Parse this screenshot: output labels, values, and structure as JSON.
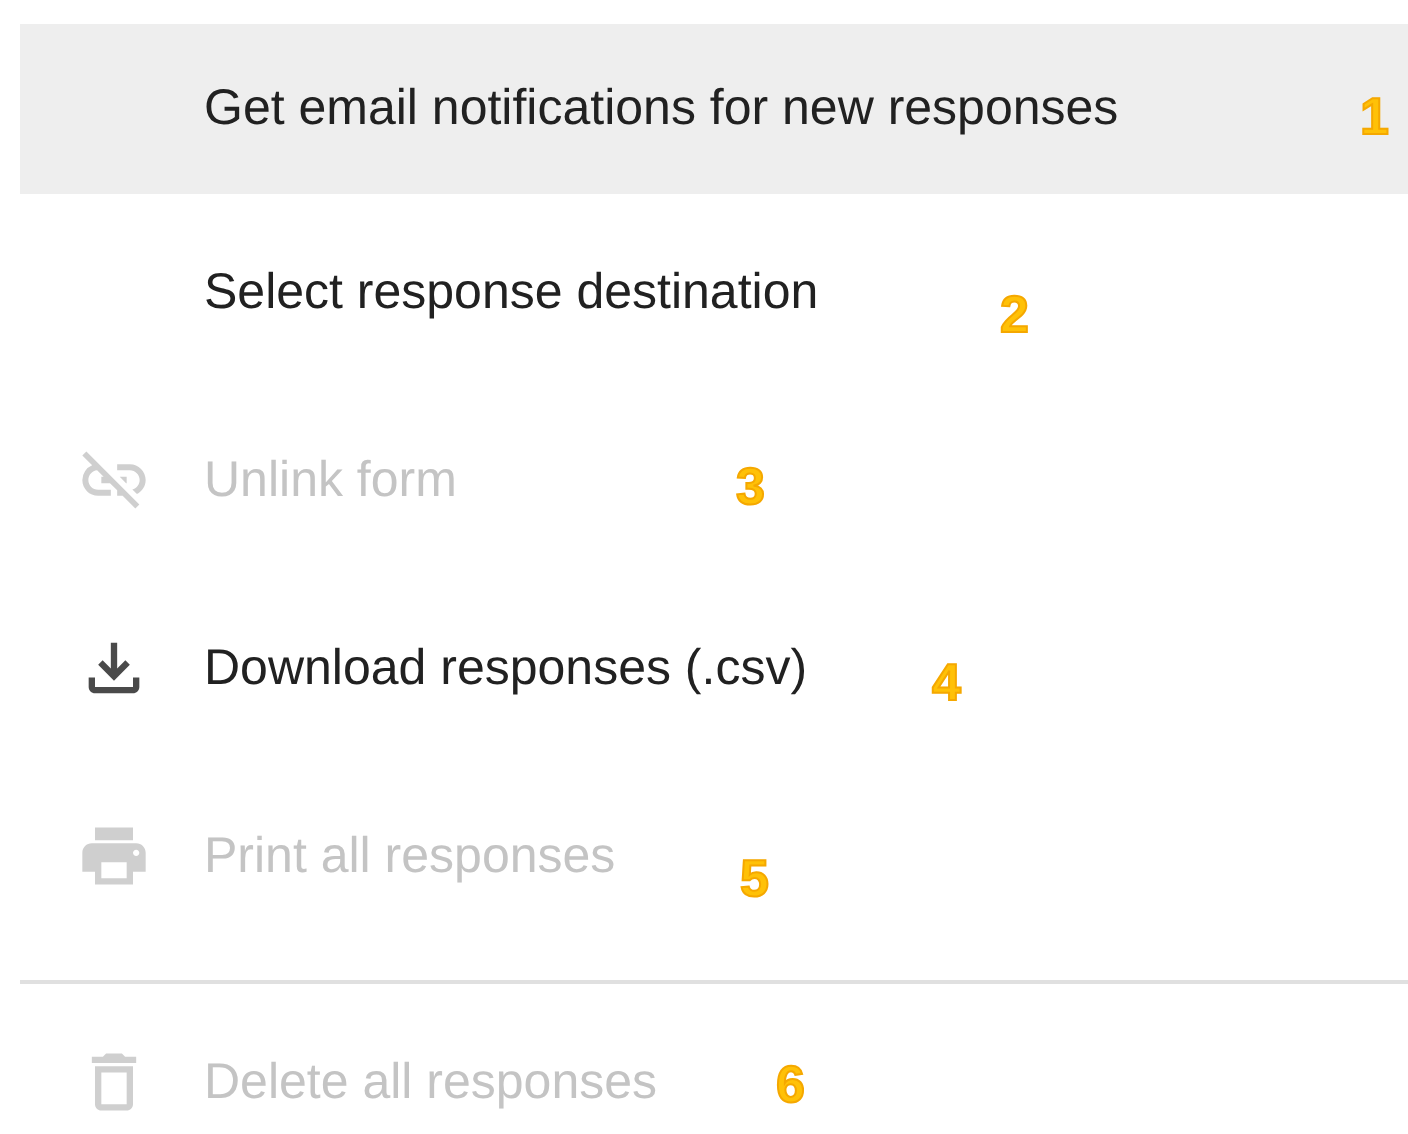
{
  "menu": {
    "groups": [
      {
        "items": [
          {
            "label": "Get email notifications for new responses",
            "marker": "1",
            "selected": true,
            "disabled": false
          },
          {
            "label": "Select response destination",
            "marker": "2",
            "selected": false,
            "disabled": false
          },
          {
            "label": "Unlink form",
            "marker": "3",
            "selected": false,
            "disabled": true
          },
          {
            "label": "Download responses (.csv)",
            "marker": "4",
            "selected": false,
            "disabled": false
          },
          {
            "label": "Print all responses",
            "marker": "5",
            "selected": false,
            "disabled": true
          }
        ]
      },
      {
        "items": [
          {
            "label": "Delete all responses",
            "marker": "6",
            "selected": false,
            "disabled": true
          }
        ]
      }
    ]
  }
}
